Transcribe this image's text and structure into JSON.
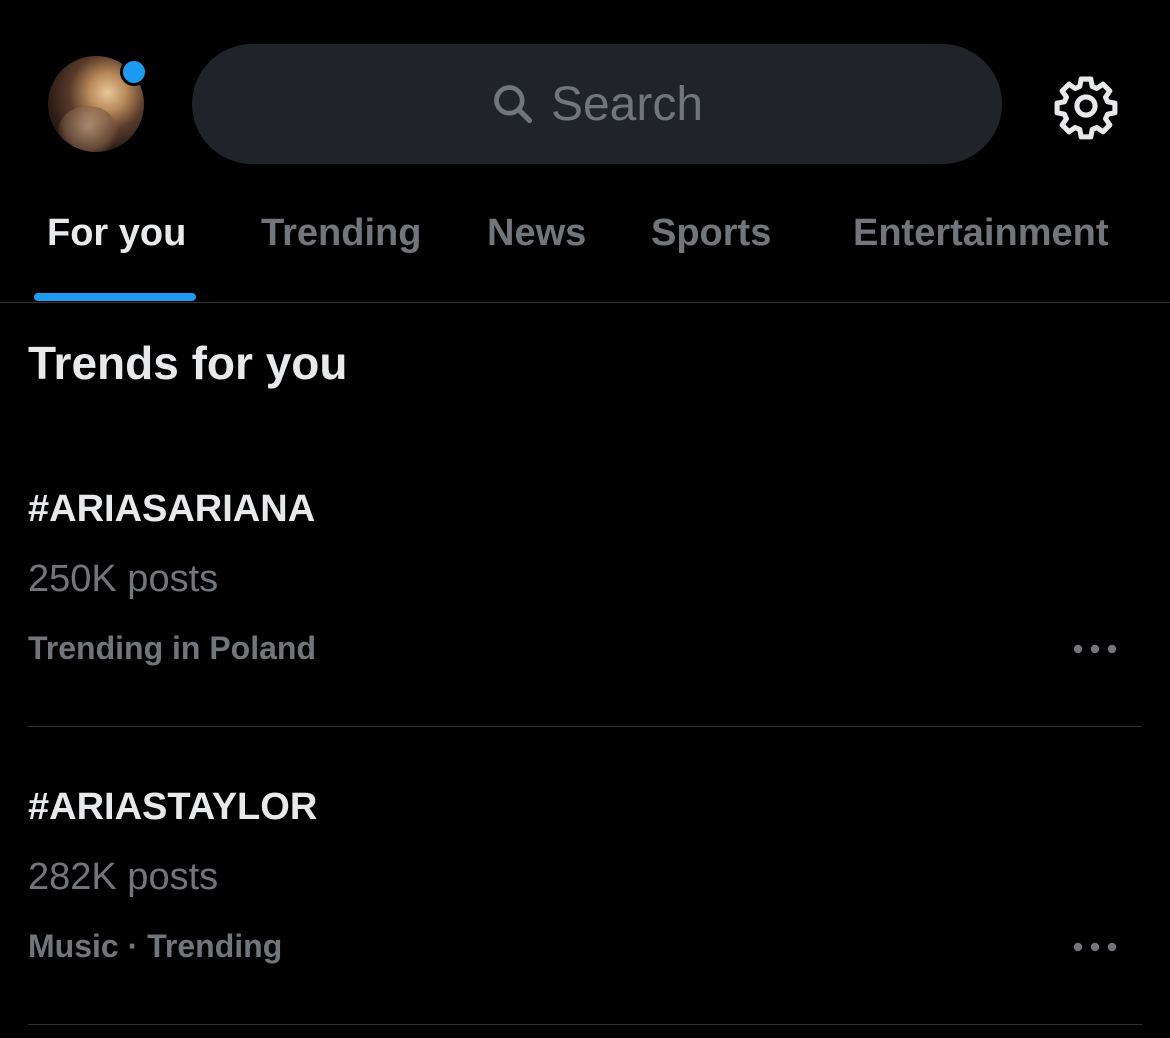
{
  "header": {
    "search_placeholder": "Search",
    "avatar_icon": "avatar",
    "settings_icon": "gear-icon",
    "notification_color": "#1d9bf0"
  },
  "tabs": [
    {
      "label": "For you",
      "active": true
    },
    {
      "label": "Trending",
      "active": false
    },
    {
      "label": "News",
      "active": false
    },
    {
      "label": "Sports",
      "active": false
    },
    {
      "label": "Entertainment",
      "active": false
    }
  ],
  "section_title": "Trends for you",
  "trends": [
    {
      "tag": "#ARIASARIANA",
      "posts": "250K posts",
      "context": "Trending in Poland"
    },
    {
      "tag": "#ARIASTAYLOR",
      "posts": "282K posts",
      "context": "Music · Trending"
    }
  ],
  "colors": {
    "background": "#000000",
    "accent": "#1d9bf0",
    "text_primary": "#e7e9ea",
    "text_secondary": "#71767b",
    "search_bg": "#202327"
  }
}
